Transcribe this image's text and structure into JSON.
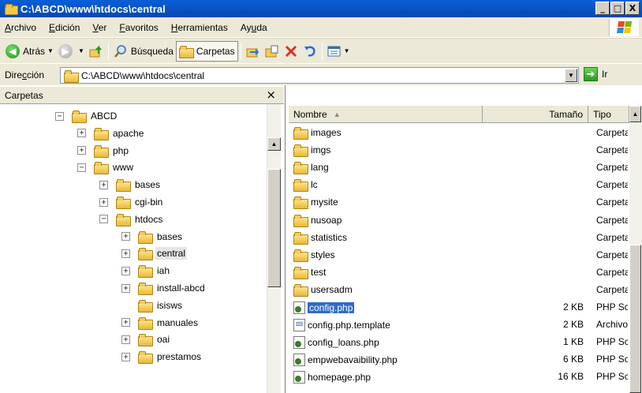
{
  "window": {
    "title": "C:\\ABCD\\www\\htdocs\\central",
    "buttons": {
      "minimize": "_",
      "maximize": "□",
      "close": "X"
    }
  },
  "menu": [
    {
      "ul": "A",
      "rest": "rchivo"
    },
    {
      "ul": "E",
      "rest": "dición"
    },
    {
      "ul": "V",
      "rest": "er"
    },
    {
      "ul": "F",
      "rest": "avoritos"
    },
    {
      "ul": "H",
      "rest": "erramientas"
    },
    {
      "pre": "Ay",
      "ul": "u",
      "rest": "da"
    }
  ],
  "toolbar": {
    "back": "Atrás",
    "search": "Búsqueda",
    "folders": "Carpetas"
  },
  "address": {
    "label_pre": "Dire",
    "label_ul": "c",
    "label_post": "ción",
    "value": "C:\\ABCD\\www\\htdocs\\central",
    "go": "Ir"
  },
  "folders_pane": {
    "title": "Carpetas",
    "close": "×"
  },
  "tree": [
    {
      "label": "ABCD",
      "exp": "−"
    },
    {
      "label": "apache",
      "exp": "+"
    },
    {
      "label": "php",
      "exp": "+"
    },
    {
      "label": "www",
      "exp": "−"
    },
    {
      "label": "bases",
      "exp": "+"
    },
    {
      "label": "cgi-bin",
      "exp": "+"
    },
    {
      "label": "htdocs",
      "exp": "−"
    },
    {
      "label": "bases",
      "exp": "+"
    },
    {
      "label": "central",
      "exp": "+",
      "selected": true
    },
    {
      "label": "iah",
      "exp": "+"
    },
    {
      "label": "install-abcd",
      "exp": "+"
    },
    {
      "label": "isisws",
      "exp": ""
    },
    {
      "label": "manuales",
      "exp": "+"
    },
    {
      "label": "oai",
      "exp": "+"
    },
    {
      "label": "prestamos",
      "exp": "+"
    }
  ],
  "columns": {
    "name": "Nombre",
    "sort_arrow": "▲",
    "size": "Tamaño",
    "type": "Tipo"
  },
  "files": [
    {
      "name": "images",
      "size": "",
      "type": "Carpeta",
      "icon": "folder"
    },
    {
      "name": "imgs",
      "size": "",
      "type": "Carpeta",
      "icon": "folder"
    },
    {
      "name": "lang",
      "size": "",
      "type": "Carpeta",
      "icon": "folder"
    },
    {
      "name": "lc",
      "size": "",
      "type": "Carpeta",
      "icon": "folder"
    },
    {
      "name": "mysite",
      "size": "",
      "type": "Carpeta",
      "icon": "folder"
    },
    {
      "name": "nusoap",
      "size": "",
      "type": "Carpeta",
      "icon": "folder"
    },
    {
      "name": "statistics",
      "size": "",
      "type": "Carpeta",
      "icon": "folder"
    },
    {
      "name": "styles",
      "size": "",
      "type": "Carpeta",
      "icon": "folder"
    },
    {
      "name": "test",
      "size": "",
      "type": "Carpeta",
      "icon": "folder"
    },
    {
      "name": "usersadm",
      "size": "",
      "type": "Carpeta",
      "icon": "folder"
    },
    {
      "name": "config.php",
      "size": "2 KB",
      "type": "PHP Script",
      "icon": "php",
      "selected": true
    },
    {
      "name": "config.php.template",
      "size": "2 KB",
      "type": "Archivo",
      "icon": "tpl"
    },
    {
      "name": "config_loans.php",
      "size": "1 KB",
      "type": "PHP Script",
      "icon": "php"
    },
    {
      "name": "empwebavaibility.php",
      "size": "6 KB",
      "type": "PHP Script",
      "icon": "php"
    },
    {
      "name": "homepage.php",
      "size": "16 KB",
      "type": "PHP Script",
      "icon": "php"
    }
  ]
}
